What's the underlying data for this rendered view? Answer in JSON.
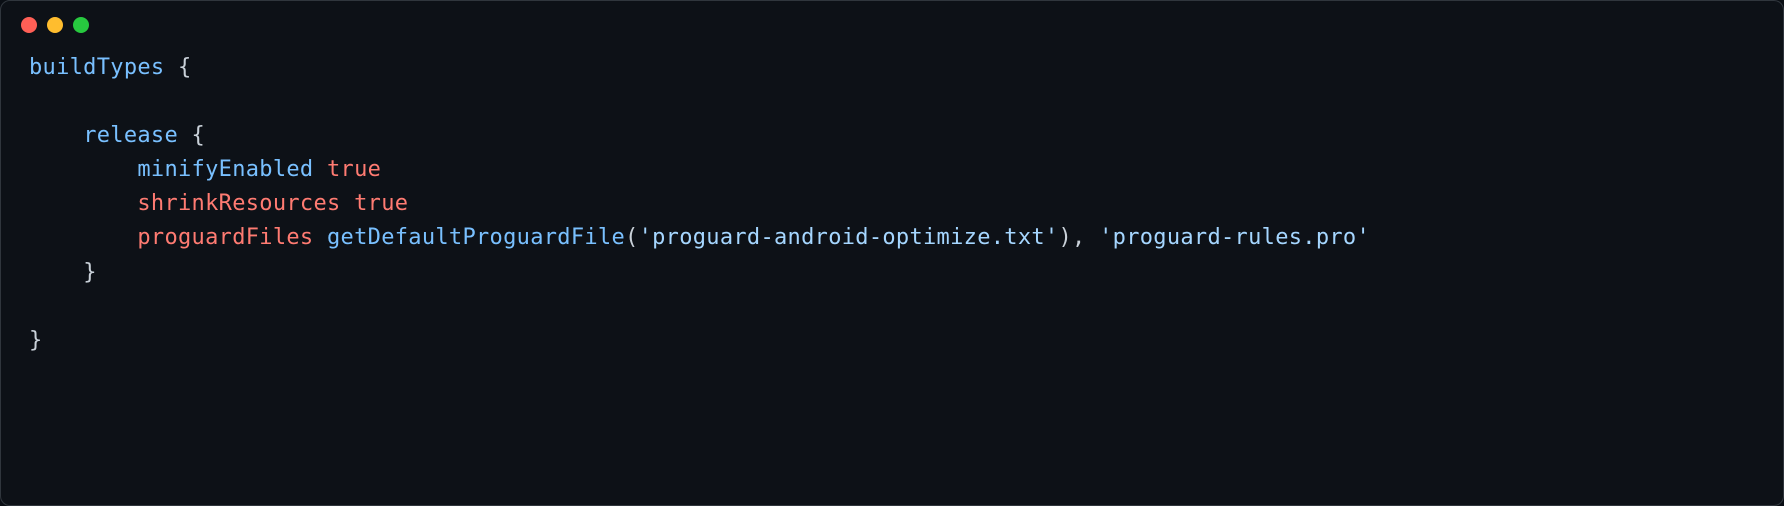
{
  "code": {
    "line1": {
      "buildTypes": "buildTypes",
      "openBrace": " {"
    },
    "blank1": "",
    "line2": {
      "indent": "    ",
      "release": "release",
      "openBrace": " {"
    },
    "line3": {
      "indent": "        ",
      "minifyEnabled": "minifyEnabled",
      "space": " ",
      "true": "true"
    },
    "line4": {
      "indent": "        ",
      "shrinkResources": "shrinkResources",
      "space": " ",
      "true": "true"
    },
    "line5": {
      "indent": "        ",
      "proguardFiles": "proguardFiles",
      "space1": " ",
      "getDefaultProguardFile": "getDefaultProguardFile",
      "openParen": "(",
      "str1": "'proguard-android-optimize.txt'",
      "closeParen": ")",
      "comma": ",",
      "space2": " ",
      "str2": "'proguard-rules.pro'"
    },
    "line6": {
      "indent": "    ",
      "closeBrace": "}"
    },
    "blank2": "",
    "line7": {
      "closeBrace": "}"
    }
  }
}
